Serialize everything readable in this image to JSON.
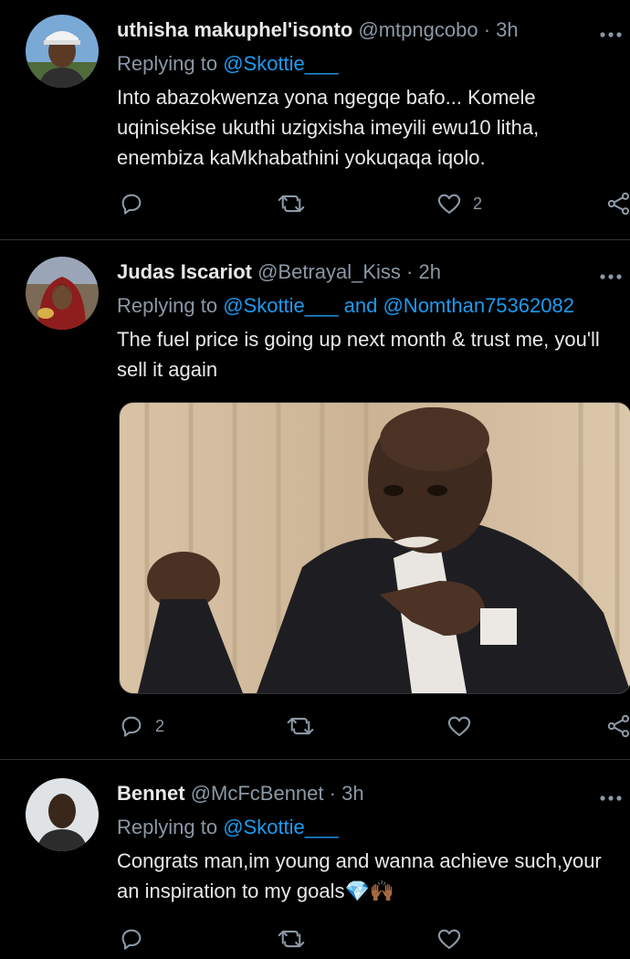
{
  "tweets": [
    {
      "name": "uthisha makuphel'isonto",
      "handle": "@mtpngcobo",
      "separator": "·",
      "time": "3h",
      "replying_prefix": "Replying to",
      "mentions": [
        "@Skottie___"
      ],
      "text": "Into abazokwenza yona ngegqe bafo... Komele uqinisekise ukuthi uzigxisha imeyili ewu10 litha, enembiza kaMkhabathini yokuqaqa iqolo.",
      "reply_count": "",
      "retweet_count": "",
      "like_count": "2"
    },
    {
      "name": "Judas Iscariot",
      "handle": "@Betrayal_Kiss",
      "separator": "·",
      "time": "2h",
      "replying_prefix": "Replying to",
      "mentions": [
        "@Skottie___",
        "@Nomthan75362082"
      ],
      "mention_joiner": "and",
      "text": "The fuel price is going up next month & trust me, you'll sell it again",
      "reply_count": "2",
      "retweet_count": "",
      "like_count": "",
      "has_media": true
    },
    {
      "name": "Bennet",
      "handle": "@McFcBennet",
      "separator": "·",
      "time": "3h",
      "replying_prefix": "Replying to",
      "mentions": [
        "@Skottie___"
      ],
      "text": "Congrats man,im young and wanna achieve such,your an inspiration to my goals💎🙌🏾"
    }
  ],
  "colors": {
    "background": "#000000",
    "text": "#e7e9ea",
    "muted": "#8b98a5",
    "link": "#1d9bf0",
    "divider": "#2f3336"
  },
  "icons": {
    "reply": "reply-icon",
    "retweet": "retweet-icon",
    "like": "heart-icon",
    "share": "share-icon",
    "more": "more-icon"
  }
}
